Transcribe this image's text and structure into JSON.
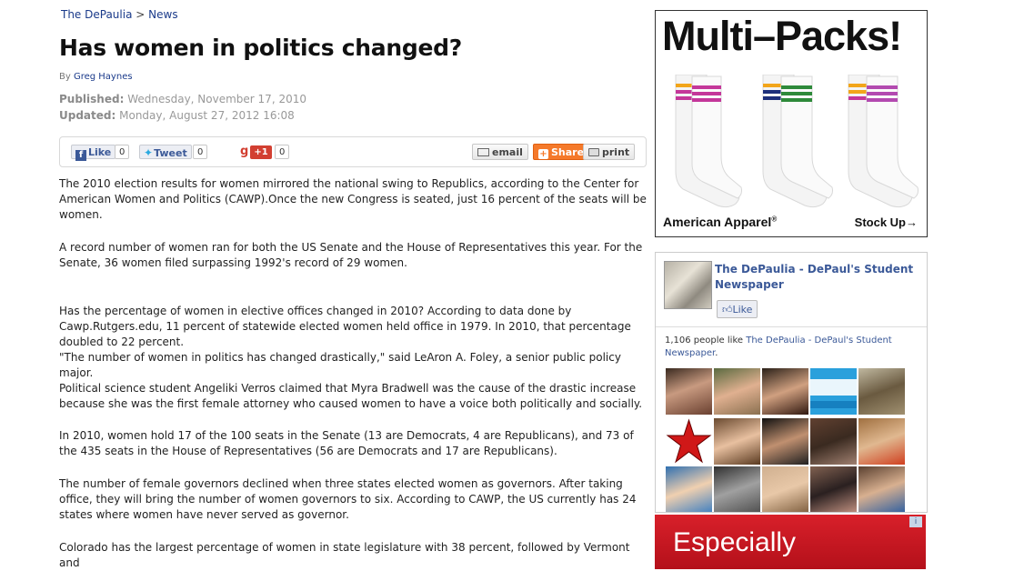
{
  "breadcrumb": {
    "site": "The DePaulia",
    "separator": ">",
    "section": "News"
  },
  "article": {
    "title": "Has women in politics changed?",
    "by_label": "By",
    "author": "Greg Haynes",
    "published_label": "Published:",
    "published": "Wednesday, November 17, 2010",
    "updated_label": "Updated:",
    "updated": "Monday, August 27, 2012 16:08",
    "paragraphs": [
      "The 2010 election results for women mirrored the national swing to Republics, according to the Center for American Women and Politics (CAWP).Once the new Congress is seated, just 16 percent of the seats will be women.",
      "A record number of women ran for both the US Senate and the House of Representatives this year. For the Senate, 36 women filed surpassing 1992's record of 29 women.",
      "Has the percentage of women in elective offices changed in 2010? According to data done by Cawp.Rutgers.edu, 11 percent of statewide elected women held office in 1979. In 2010, that percentage doubled to 22 percent.",
      "\"The number of women in politics has changed drastically,\" said LeAron A. Foley, a senior public policy major.",
      "Political science student Angeliki Verros claimed that Myra Bradwell was the cause of the drastic increase because she was the first female attorney who caused women to have a voice both politically and socially.",
      "In 2010, women hold 17 of the 100 seats in the Senate (13 are Democrats, 4 are Republicans), and 73 of the 435 seats in the House of Representatives (56 are Democrats and 17 are Republicans).",
      "The number of female governors declined when three states elected women as governors. After taking office, they will bring the number of women governors to six. According to CAWP, the US currently has 24 states where women have never served as governor.",
      "Colorado has the largest percentage of women in state legislature with 38 percent, followed by Vermont and"
    ]
  },
  "share": {
    "fb_like_label": "Like",
    "fb_like_count": "0",
    "tweet_label": "Tweet",
    "tweet_count": "0",
    "gplus_label": "+1",
    "gplus_count": "0",
    "email_label": "email",
    "share_label": "Share",
    "print_label": "print"
  },
  "ad_top": {
    "headline": "Multi–Packs!",
    "brand": "American Apparel",
    "brand_mark": "®",
    "cta": "Stock Up→",
    "stripe_colors": [
      "#f2a51a",
      "#c4379a",
      "#1d2f7a",
      "#2e8a3a",
      "#b34ab0"
    ]
  },
  "fb_box": {
    "page_name": "The DePaulia - DePaul's Student Newspaper",
    "like_label": "Like",
    "count_text": "1,106 people like",
    "count_link": "The DePaulia - DePaul's Student Newspaper",
    "count_end": "."
  },
  "ad_bottom": {
    "text": "Especially",
    "choice": "i"
  },
  "colors": {
    "link": "#1a3a8a",
    "fb_blue": "#3b5998",
    "share_orange": "#f5792a",
    "ad_red": "#c8161e"
  }
}
